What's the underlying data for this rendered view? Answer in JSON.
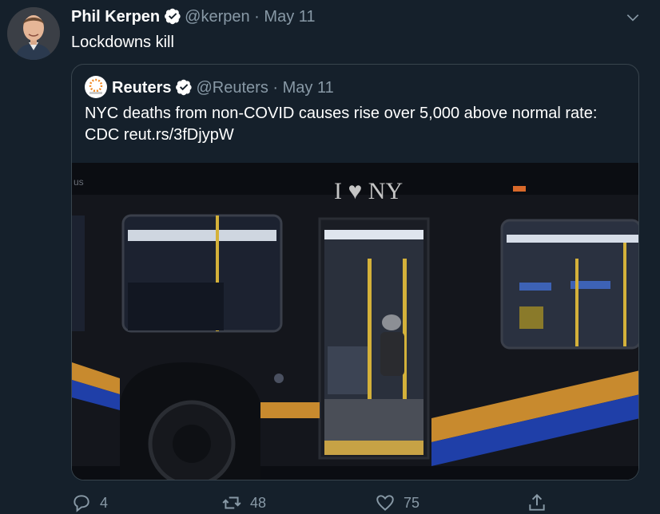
{
  "tweet": {
    "author_name": "Phil Kerpen",
    "author_handle": "@kerpen",
    "separator": "·",
    "date": "May 11",
    "text": "Lockdowns kill"
  },
  "quoted_tweet": {
    "author_name": "Reuters",
    "author_handle": "@Reuters",
    "separator": "·",
    "date": "May 11",
    "text": "NYC deaths from non-COVID causes rise over 5,000 above normal rate: CDC reut.rs/3fDjypW",
    "image": {
      "subject": "bus",
      "bus_text": "I ♥ NY",
      "left_text": "us"
    }
  },
  "actions": {
    "replies": "4",
    "retweets": "48",
    "likes": "75"
  },
  "colors": {
    "background": "#15202b",
    "muted": "#8899a6",
    "verified": "#ffffff",
    "heart": "#e0245e"
  },
  "icons": [
    "verified-badge-icon",
    "chevron-down-icon",
    "reply-icon",
    "retweet-icon",
    "like-icon",
    "share-icon"
  ]
}
